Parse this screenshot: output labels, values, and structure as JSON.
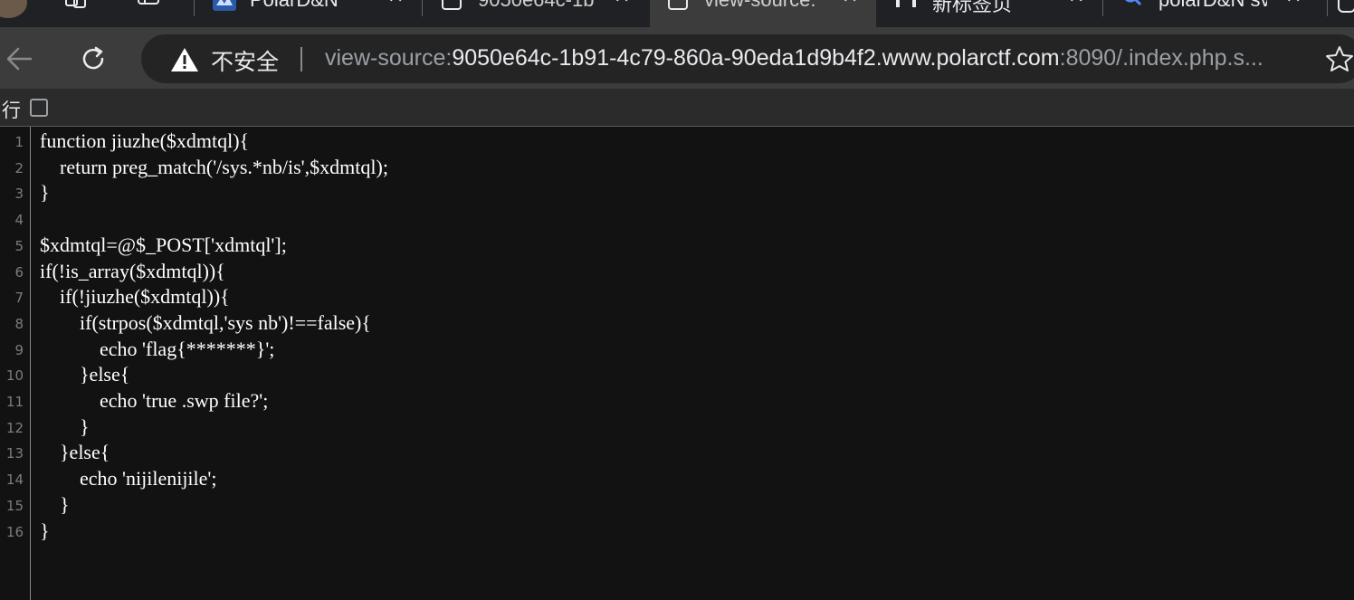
{
  "browser": {
    "tabs": [
      {
        "title": "PolarD&N",
        "active": false
      },
      {
        "title": "9050e64c-1b",
        "active": false
      },
      {
        "title": "view-source:",
        "active": true
      },
      {
        "title": "新标签页",
        "active": false
      },
      {
        "title": "polarD&N sv",
        "active": false
      }
    ],
    "tab_close_glyph": "✕"
  },
  "toolbar": {
    "security_label": "不安全",
    "url_scheme": "view-source:",
    "url_host": "9050e64c-1b91-4c79-860a-90eda1d9b4f2.www.polarctf.com",
    "url_rest": ":8090/.index.php.s..."
  },
  "wrap": {
    "label": "行"
  },
  "source": {
    "lines": [
      {
        "n": "1",
        "text": "function jiuzhe($xdmtql){"
      },
      {
        "n": "2",
        "text": "    return preg_match('/sys.*nb/is',$xdmtql);"
      },
      {
        "n": "3",
        "text": "}"
      },
      {
        "n": "4",
        "text": ""
      },
      {
        "n": "5",
        "text": "$xdmtql=@$_POST['xdmtql'];"
      },
      {
        "n": "6",
        "text": "if(!is_array($xdmtql)){"
      },
      {
        "n": "7",
        "text": "    if(!jiuzhe($xdmtql)){"
      },
      {
        "n": "8",
        "text": "        if(strpos($xdmtql,'sys nb')!==false){"
      },
      {
        "n": "9",
        "text": "            echo 'flag{*******}';"
      },
      {
        "n": "10",
        "text": "        }else{"
      },
      {
        "n": "11",
        "text": "            echo 'true .swp file?';"
      },
      {
        "n": "12",
        "text": "        }"
      },
      {
        "n": "13",
        "text": "    }else{"
      },
      {
        "n": "14",
        "text": "        echo 'nijilenijile';"
      },
      {
        "n": "15",
        "text": "    }"
      },
      {
        "n": "16",
        "text": "}"
      }
    ]
  },
  "colors": {
    "background": "#121212",
    "toolbar": "#3c3c3c",
    "omnibox": "#242424",
    "code_text": "#ffffff",
    "line_number": "#7d7d7d"
  }
}
